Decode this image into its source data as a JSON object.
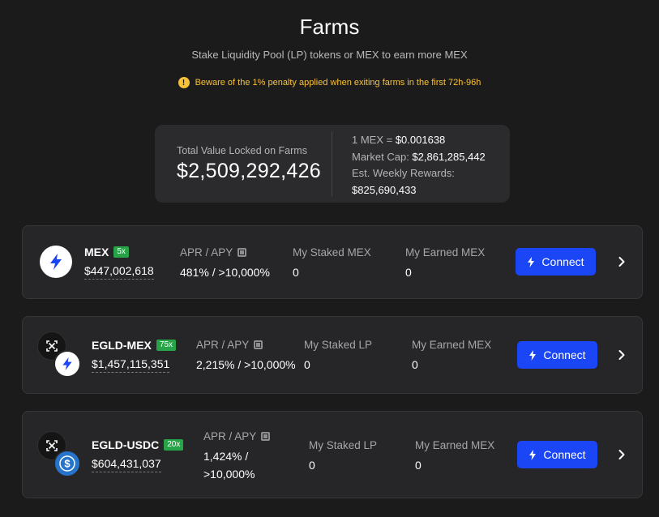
{
  "header": {
    "title": "Farms",
    "subtitle": "Stake Liquidity Pool (LP) tokens or MEX to earn more MEX",
    "warning": "Beware of the 1% penalty applied when exiting farms in the first 72h-96h"
  },
  "summary": {
    "tvl_label": "Total Value Locked on Farms",
    "tvl_value": "$2,509,292,426",
    "price_label": "1 MEX = ",
    "price_value": "$0.001638",
    "mcap_label": "Market Cap: ",
    "mcap_value": "$2,861,285,442",
    "rewards_label": "Est. Weekly Rewards:",
    "rewards_value": "$825,690,433"
  },
  "farms": [
    {
      "name": "MEX",
      "multiplier": "5x",
      "tvl": "$447,002,618",
      "apr_label": "APR / APY",
      "apr_value": "481% / >10,000%",
      "staked_label": "My Staked MEX",
      "staked_value": "0",
      "earned_label": "My Earned MEX",
      "earned_value": "0",
      "button": "Connect"
    },
    {
      "name": "EGLD-MEX",
      "multiplier": "75x",
      "tvl": "$1,457,115,351",
      "apr_label": "APR / APY",
      "apr_value": "2,215% / >10,000%",
      "staked_label": "My Staked LP",
      "staked_value": "0",
      "earned_label": "My Earned MEX",
      "earned_value": "0",
      "button": "Connect"
    },
    {
      "name": "EGLD-USDC",
      "multiplier": "20x",
      "tvl": "$604,431,037",
      "apr_label": "APR / APY",
      "apr_value_line1": "1,424% /",
      "apr_value_line2": ">10,000%",
      "staked_label": "My Staked LP",
      "staked_value": "0",
      "earned_label": "My Earned MEX",
      "earned_value": "0",
      "button": "Connect"
    }
  ],
  "colors": {
    "background": "#1b1b1b",
    "card": "#262628",
    "accent_blue": "#1b46f5",
    "multiplier_green": "#27a447",
    "warning_yellow": "#f6c23a",
    "usdc_blue": "#2775ca"
  },
  "icons": [
    "warning-icon",
    "mex-token-icon",
    "egld-token-icon",
    "usdc-token-icon",
    "calculator-icon",
    "lightning-icon",
    "chevron-right-icon"
  ]
}
